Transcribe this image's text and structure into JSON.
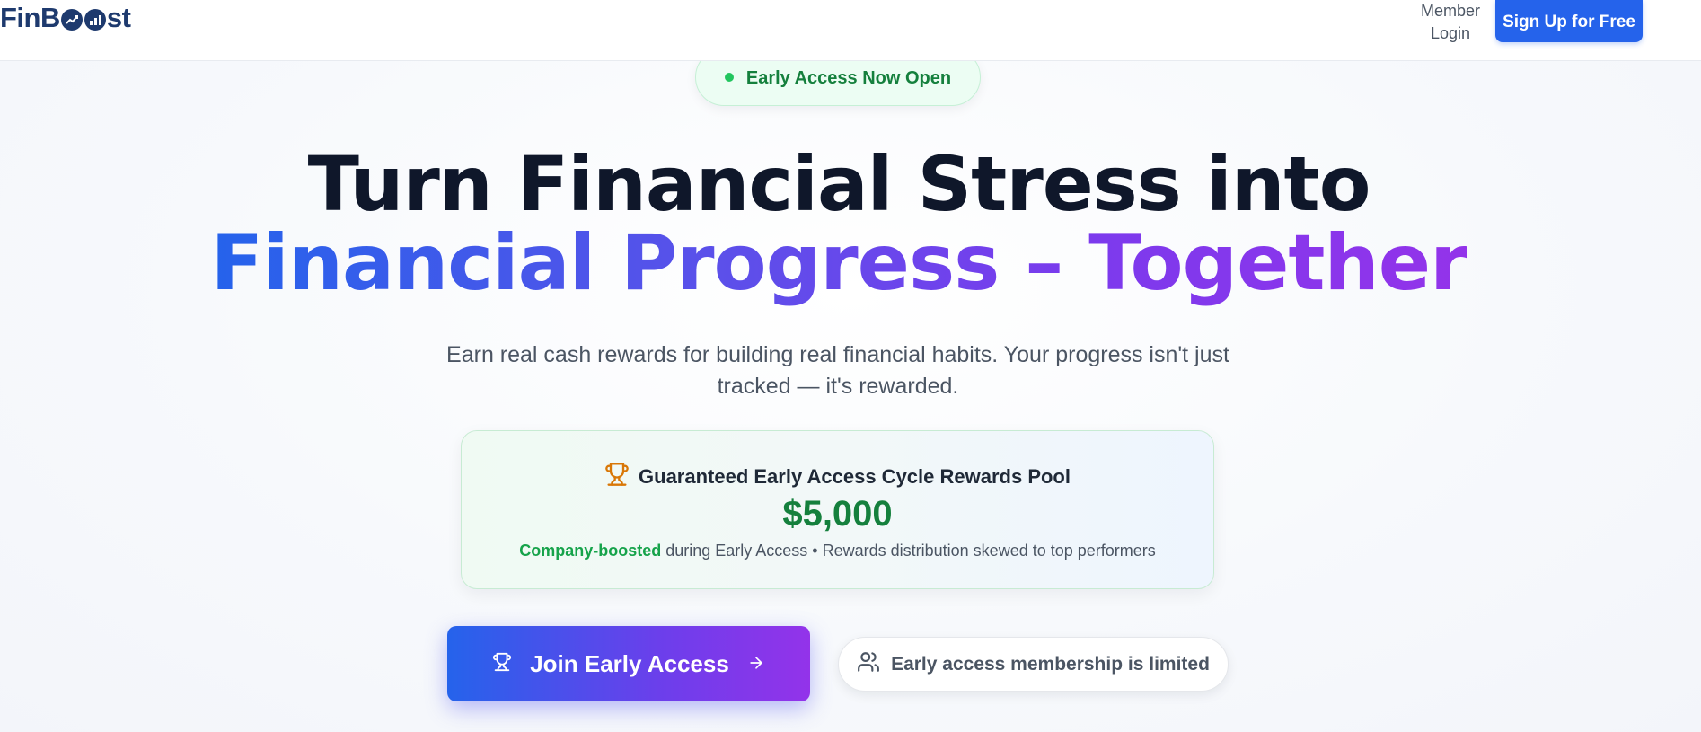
{
  "header": {
    "logo_text_left": "FinB",
    "logo_text_right": "st",
    "member_login_line1": "Member",
    "member_login_line2": "Login",
    "signup_label": "Sign Up for Free"
  },
  "badge": {
    "label": "Early Access Now Open",
    "dot_color": "#22c55e"
  },
  "hero": {
    "headline_line1": "Turn Financial Stress into",
    "headline_line2": "Financial Progress – Together",
    "subtitle": "Earn real cash rewards for building real financial habits. Your progress isn't just tracked — it's rewarded."
  },
  "reward_pool": {
    "icon": "trophy-icon",
    "title": "Guaranteed Early Access Cycle Rewards Pool",
    "amount": "$5,000",
    "note_highlight": "Company-boosted",
    "note_rest": " during Early Access • Rewards distribution skewed to top performers"
  },
  "cta": {
    "join_label": "Join Early Access",
    "join_icon": "trophy-icon",
    "join_arrow_icon": "arrow-right-icon",
    "limited_icon": "users-icon",
    "limited_label": "Early access membership is limited"
  },
  "colors": {
    "brand_navy": "#1e3a6e",
    "primary_blue": "#2563eb",
    "accent_purple": "#9333ea",
    "success_green": "#15803d"
  }
}
